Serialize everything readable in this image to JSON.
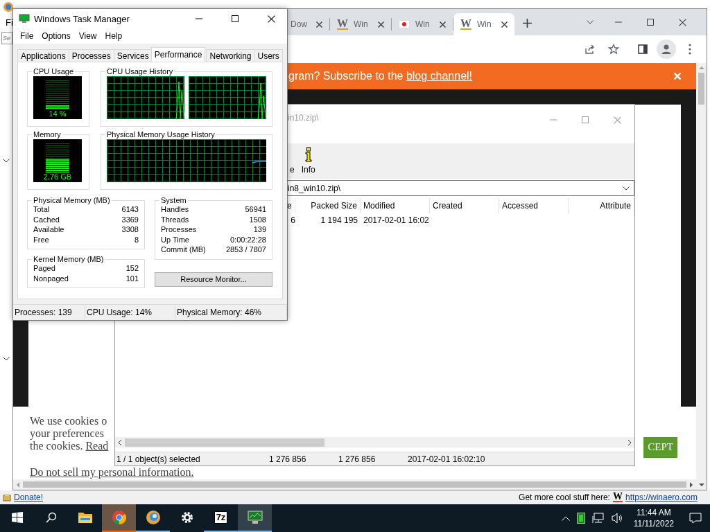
{
  "background_app": {
    "menu": [
      "Fi"
    ],
    "search": {
      "placeholder": "Se"
    },
    "footer": {
      "link": "Donate!",
      "promo": "Get more cool stuff here:",
      "promo_logo": "W",
      "url": "https://winaero.com"
    }
  },
  "browser": {
    "tabs": [
      {
        "label": "Dow",
        "kind": "plain",
        "selected": false
      },
      {
        "label": "Win",
        "kind": "logo",
        "favicon": "W",
        "selected": false
      },
      {
        "label": "Win",
        "kind": "flag",
        "selected": false
      },
      {
        "label": "Win",
        "kind": "logo",
        "favicon": "W",
        "selected": true
      }
    ],
    "banner": {
      "text": "gram? Subscribe to the ",
      "link": "blog channel!"
    },
    "cookie_notice": {
      "lines": [
        "We use cookies o",
        "your preferences"
      ],
      "last_line": "the cookies. ",
      "link": "Read",
      "opt_out": "Do not sell my personal information.",
      "accept": "CEPT"
    }
  },
  "archive_window": {
    "title": "in10.zip\\",
    "toolbar": [
      {
        "label": "e",
        "kind": "text"
      },
      {
        "label": "Info",
        "kind": "info"
      }
    ],
    "address": "in8_win10.zip\\",
    "columns": [
      "e",
      "Packed Size",
      "Modified",
      "Created",
      "Accessed",
      "Attribute"
    ],
    "rows": [
      [
        "6",
        "1 194 195",
        "2017-02-01 16:02"
      ]
    ],
    "status_bar": [
      "1 / 1 object(s) selected",
      "1 276 856",
      "1 276 856",
      "2017-02-01 16:02:10"
    ]
  },
  "task_manager": {
    "title": "Windows Task Manager",
    "menu": [
      "File",
      "Options",
      "View",
      "Help"
    ],
    "tabs": [
      {
        "label": "Applications",
        "selected": false
      },
      {
        "label": "Processes",
        "selected": false
      },
      {
        "label": "Services",
        "selected": false
      },
      {
        "label": "Performance",
        "selected": true
      },
      {
        "label": "Networking",
        "selected": false
      },
      {
        "label": "Users",
        "selected": false
      }
    ],
    "cpu_usage": {
      "title": "CPU Usage",
      "reading": "14 %",
      "level": 0.14
    },
    "cpu_history": {
      "title": "CPU Usage History"
    },
    "memory": {
      "title": "Memory",
      "reading": "2.76 GB",
      "level": 0.46
    },
    "memory_history": {
      "title": "Physical Memory Usage History"
    },
    "physical_memory": {
      "title": "Physical Memory (MB)",
      "rows": [
        {
          "label": "Total",
          "value": "6143"
        },
        {
          "label": "Cached",
          "value": "3369"
        },
        {
          "label": "Available",
          "value": "3308"
        },
        {
          "label": "Free",
          "value": "8"
        }
      ]
    },
    "kernel_memory": {
      "title": "Kernel Memory (MB)",
      "rows": [
        {
          "label": "Paged",
          "value": "152"
        },
        {
          "label": "Nonpaged",
          "value": "101"
        }
      ]
    },
    "system": {
      "title": "System",
      "rows": [
        {
          "label": "Handles",
          "value": "56941"
        },
        {
          "label": "Threads",
          "value": "1508"
        },
        {
          "label": "Processes",
          "value": "139"
        },
        {
          "label": "Up Time",
          "value": "0:00:22:28"
        },
        {
          "label": "Commit (MB)",
          "value": "2853 / 7807"
        }
      ]
    },
    "resource_monitor_button": "Resource Monitor...",
    "status_bar": [
      "Processes: 139",
      "CPU Usage: 14%",
      "Physical Memory: 46%"
    ]
  },
  "taskbar": {
    "apps": [
      {
        "kind": "start",
        "open": false,
        "selected": false,
        "flashing": false
      },
      {
        "kind": "search",
        "open": false,
        "selected": false,
        "flashing": false
      },
      {
        "kind": "folder",
        "open": false,
        "selected": false,
        "flashing": false
      },
      {
        "kind": "browser",
        "open": true,
        "selected": false,
        "flashing": true
      },
      {
        "kind": "tweaker",
        "open": true,
        "selected": false,
        "flashing": false
      },
      {
        "kind": "settings",
        "open": false,
        "selected": false,
        "flashing": false
      },
      {
        "kind": "archiver",
        "label": "7z",
        "open": true,
        "selected": false,
        "flashing": false
      },
      {
        "kind": "monitor",
        "open": true,
        "selected": true,
        "flashing": false
      }
    ],
    "time": "11:44 AM",
    "date": "11/11/2022"
  }
}
